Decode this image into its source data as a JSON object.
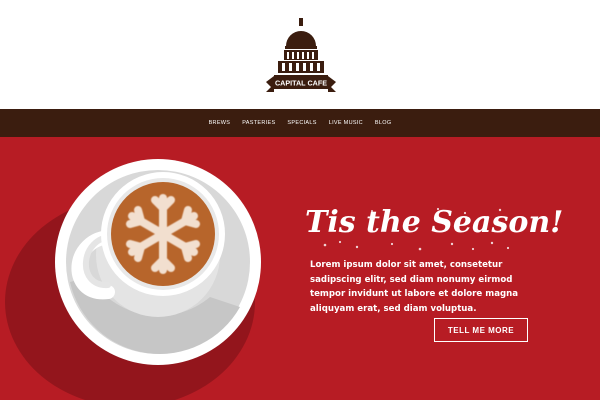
{
  "brand": {
    "name": "CAPITAL CAFE",
    "colors": {
      "header_bg": "#ffffff",
      "nav_bg": "#3b1d0f",
      "hero_bg": "#b71c24",
      "coffee": "#b7652b",
      "text": "#ffffff"
    }
  },
  "nav": {
    "items": [
      {
        "label": "BREWS"
      },
      {
        "label": "PASTERIES"
      },
      {
        "label": "SPECIALS"
      },
      {
        "label": "LIVE MUSIC"
      },
      {
        "label": "BLOG"
      }
    ]
  },
  "hero": {
    "title": "Tis the Season!",
    "body": "Lorem ipsum dolor sit amet, consetetur sadipscing elitr, sed diam nonumy eirmod tempor invidunt ut labore et dolore magna aliquyam erat, sed diam voluptua.",
    "cta_label": "TELL ME MORE",
    "illustration_icon": "snowflake-icon"
  }
}
